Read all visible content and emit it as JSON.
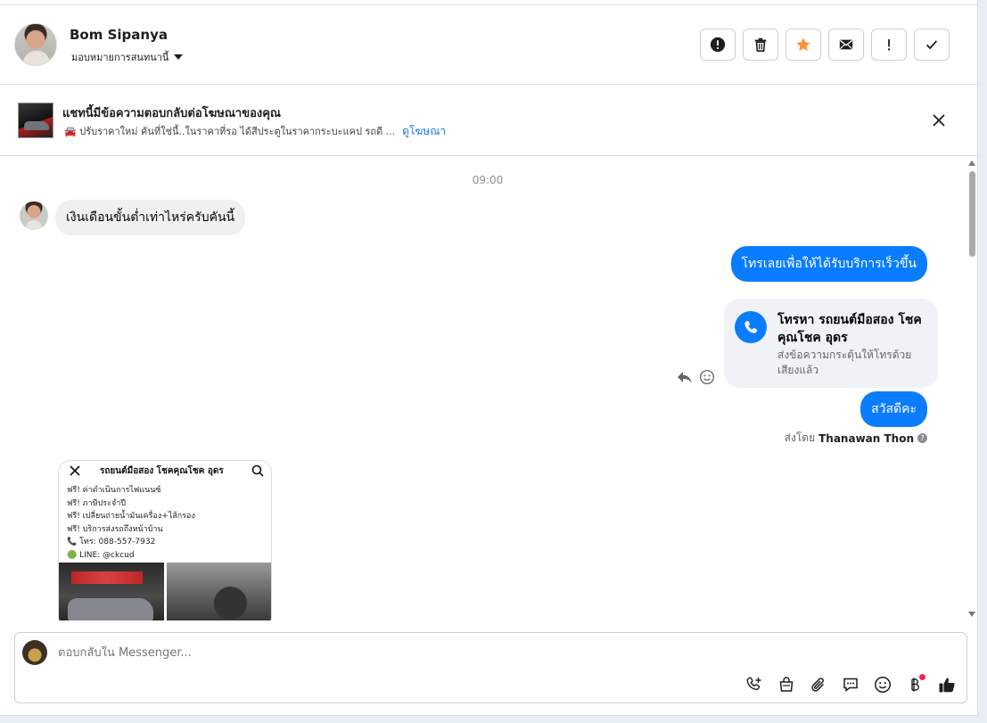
{
  "header": {
    "contact_name": "Bom Sipanya",
    "assign_label": "มอบหมายการสนทนานี้",
    "actions": [
      "spam-report",
      "delete",
      "star",
      "mark-unread",
      "follow-up",
      "done"
    ]
  },
  "ad_banner": {
    "title": "แชทนี้มีข้อความตอบกลับต่อโฆษณาของคุณ",
    "snippet": "🚘 ปรับราคาใหม่ คันที่ใช่นี้..ในราคาที่รอ ได้สีประตูในราคากระบะแคป รถดี ...",
    "link": "ดูโฆษณา"
  },
  "conversation": {
    "time": "09:00",
    "incoming_message": "เงินเดือนขั้นต่ำเท่าไหร่ครับคันนี้",
    "outgoing_1": "โทรเลยเพื่อให้ได้รับบริการเร็วขึ้น",
    "call_card": {
      "title": "โทรหา รถยนต์มือสอง โชคคุณโชค อุดร",
      "subtitle": "ส่งข้อความกระตุ้นให้โทรด้วยเสียงแล้ว"
    },
    "outgoing_2": "สวัสดีคะ",
    "sent_by_prefix": "ส่งโดย",
    "sent_by_name": "Thanawan Thon",
    "help": "?",
    "post": {
      "title": "รถยนต์มือสอง โชคคุณโชค อุดร",
      "lines": [
        "ฟรี! ค่าดำเนินการไฟแนนซ์",
        "ฟรี! ภาษีประจำปี",
        "ฟรี! เปลี่ยนถ่ายน้ำมันเครื่อง+ไส้กรอง",
        "ฟรี! บริการส่งรถถึงหน้าบ้าน",
        "📞 โทร: 088-557-7932",
        "🟢 LINE: @ckcud"
      ]
    }
  },
  "composer": {
    "placeholder": "ตอบกลับใน Messenger...",
    "tools": [
      "add-call-icon",
      "shopping-bag-icon",
      "attachment-icon",
      "saved-reply-icon",
      "emoji-icon",
      "baht-icon",
      "thumbs-up-icon"
    ]
  },
  "colors": {
    "accent": "#0a7cff",
    "star": "#f7923b",
    "link": "#1b74e4"
  }
}
